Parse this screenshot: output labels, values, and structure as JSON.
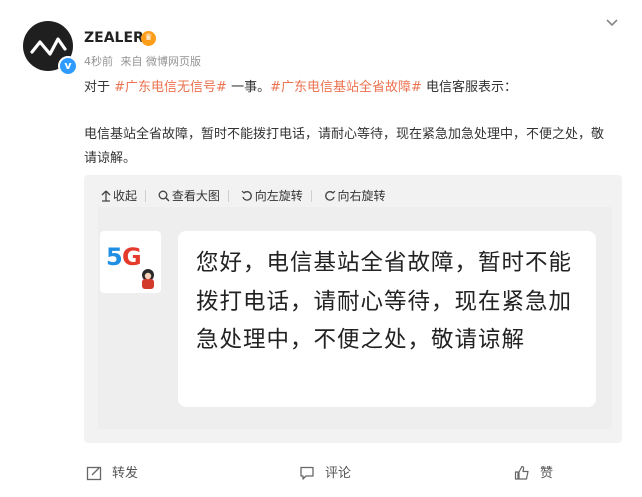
{
  "post": {
    "author": "ZEALER",
    "time": "4秒前",
    "source": "来自 微博网页版",
    "intro_prefix": "对于 ",
    "hashtag1": "#广东电信无信号#",
    "intro_middle": " 一事。",
    "hashtag2": "#广东电信基站全省故障#",
    "intro_suffix": " 电信客服表示：",
    "body": "电信基站全省故障，暂时不能拨打电话，请耐心等待，现在紧急加急处理中，不便之处，敬请谅解。"
  },
  "image_toolbar": {
    "collapse": "收起",
    "view_large": "查看大图",
    "rotate_left": "向左旋转",
    "rotate_right": "向右旋转"
  },
  "image": {
    "logo_text": "5G",
    "bubble_text": "您好，电信基站全省故障，暂时不能拨打电话，请耐心等待，现在紧急加急处理中，不便之处，敬请谅解"
  },
  "actions": {
    "repost": "转发",
    "comment": "评论",
    "like": "赞"
  },
  "icons": {
    "verified": "verified-badge-icon",
    "crown": "vip-crown-icon",
    "menu": "chevron-down-icon",
    "collapse": "collapse-arrow-icon",
    "zoom": "magnifier-icon",
    "rotate_left": "rotate-left-icon",
    "rotate_right": "rotate-right-icon",
    "repost": "repost-icon",
    "comment": "comment-icon",
    "like": "thumbs-up-icon"
  },
  "colors": {
    "hashtag": "#eb7350",
    "verified": "#2f9bff",
    "gallery_bg": "#f2f2f2",
    "logo_blue": "#1f8fe3",
    "logo_red": "#e43b2d"
  }
}
